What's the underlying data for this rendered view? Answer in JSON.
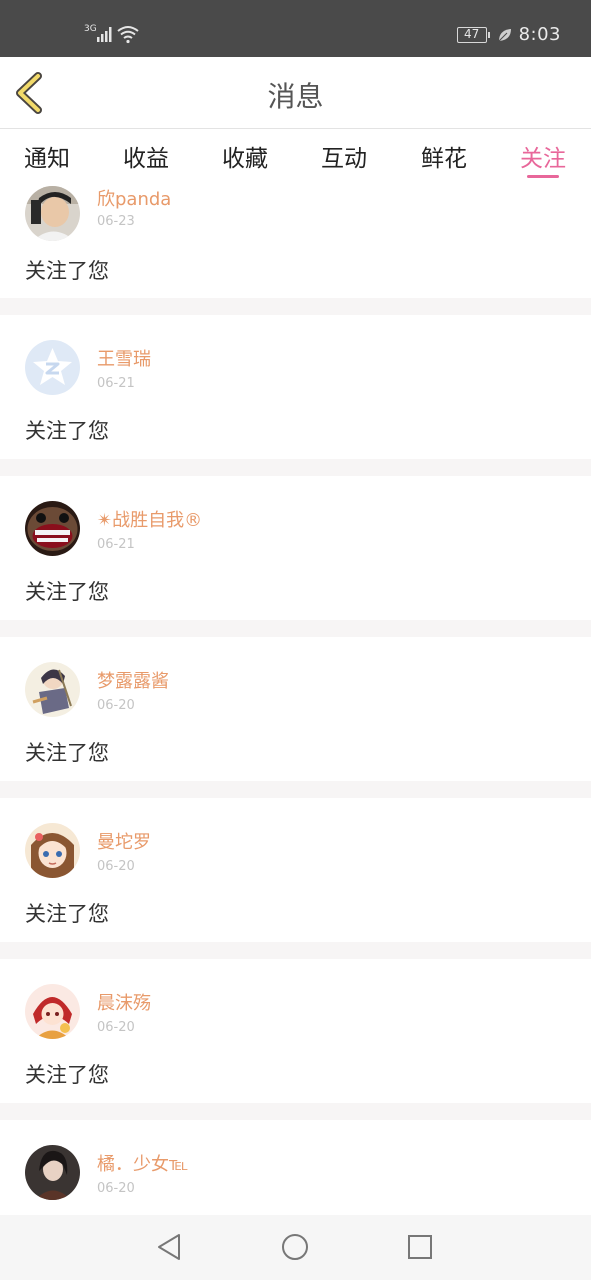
{
  "status_bar": {
    "network": "3G",
    "battery": "47",
    "time": "8:03"
  },
  "header": {
    "title": "消息"
  },
  "tabs": [
    {
      "label": "通知",
      "active": false
    },
    {
      "label": "收益",
      "active": false
    },
    {
      "label": "收藏",
      "active": false
    },
    {
      "label": "互动",
      "active": false
    },
    {
      "label": "鲜花",
      "active": false
    },
    {
      "label": "关注",
      "active": true
    }
  ],
  "accent_color": "#e8679a",
  "name_color": "#e89a6a",
  "feed": [
    {
      "name": "欣panda",
      "date": "06-23",
      "text": "关注了您",
      "avatar": "photo-avatar"
    },
    {
      "name": "王雪瑞",
      "date": "06-21",
      "text": "关注了您",
      "avatar": "default-z-avatar"
    },
    {
      "name": "✴战胜自我®",
      "date": "06-21",
      "text": "关注了您",
      "avatar": "pug-avatar"
    },
    {
      "name": "梦露露酱",
      "date": "06-20",
      "text": "关注了您",
      "avatar": "anime-avatar"
    },
    {
      "name": "曼坨罗",
      "date": "06-20",
      "text": "关注了您",
      "avatar": "anime-avatar"
    },
    {
      "name": "晨沫殇",
      "date": "06-20",
      "text": "关注了您",
      "avatar": "anime-avatar"
    },
    {
      "name": "橘．少女℡",
      "date": "06-20",
      "text": "",
      "avatar": "photo-avatar"
    }
  ],
  "nav": {
    "back": "back-triangle-icon",
    "home": "home-circle-icon",
    "recents": "recents-square-icon"
  }
}
